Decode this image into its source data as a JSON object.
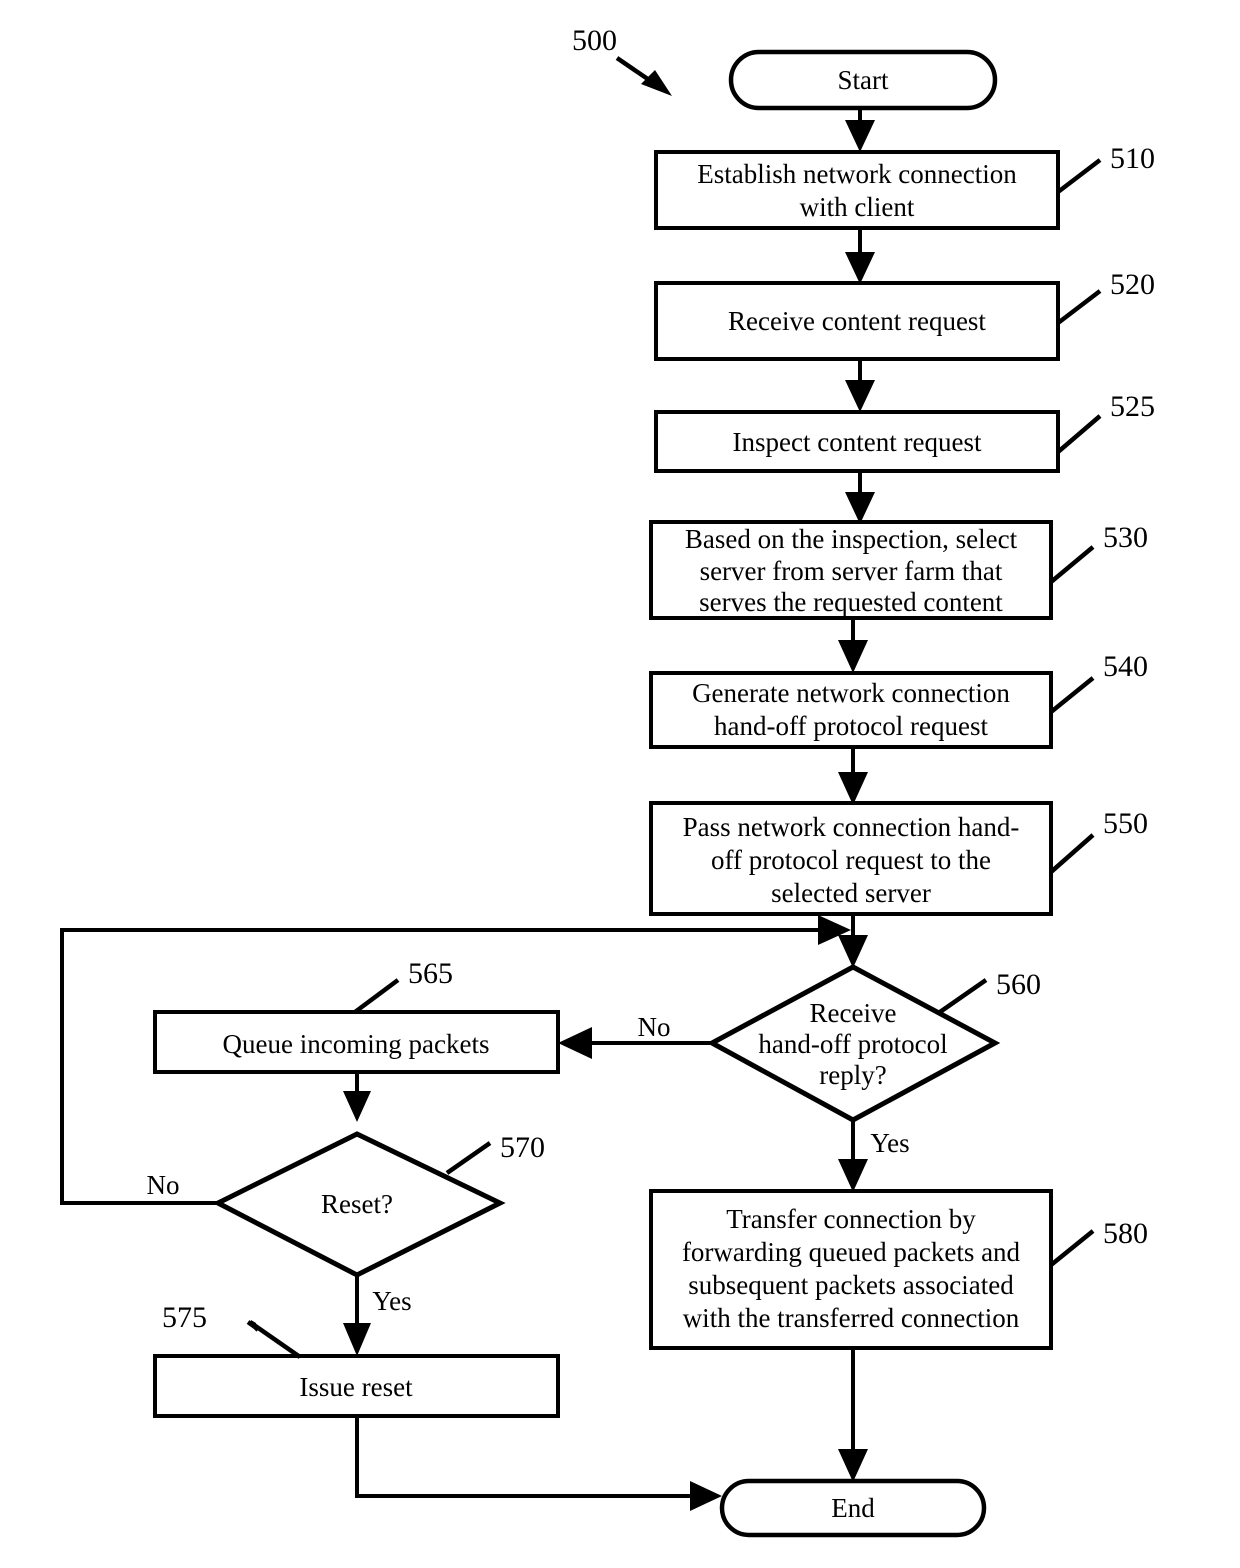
{
  "figure": {
    "figure_number": "500",
    "nodes": [
      {
        "id": "start",
        "ref": "",
        "type": "terminal",
        "label": "Start"
      },
      {
        "id": "n510",
        "ref": "510",
        "type": "process",
        "lines": [
          "Establish network connection",
          "with client"
        ]
      },
      {
        "id": "n520",
        "ref": "520",
        "type": "process",
        "lines": [
          "Receive content request"
        ]
      },
      {
        "id": "n525",
        "ref": "525",
        "type": "process",
        "lines": [
          "Inspect content request"
        ]
      },
      {
        "id": "n530",
        "ref": "530",
        "type": "process",
        "lines": [
          "Based on the inspection, select",
          "server from server farm that",
          "serves the requested content"
        ]
      },
      {
        "id": "n540",
        "ref": "540",
        "type": "process",
        "lines": [
          "Generate network connection",
          "hand-off protocol request"
        ]
      },
      {
        "id": "n550",
        "ref": "550",
        "type": "process",
        "lines": [
          "Pass network connection hand-",
          "off protocol request to the",
          "selected server"
        ]
      },
      {
        "id": "n560",
        "ref": "560",
        "type": "decision",
        "lines": [
          "Receive",
          "hand-off protocol",
          "reply?"
        ]
      },
      {
        "id": "n565",
        "ref": "565",
        "type": "process",
        "lines": [
          "Queue incoming packets"
        ]
      },
      {
        "id": "n570",
        "ref": "570",
        "type": "decision",
        "lines": [
          "Reset?"
        ]
      },
      {
        "id": "n575",
        "ref": "575",
        "type": "process",
        "lines": [
          "Issue reset"
        ]
      },
      {
        "id": "n580",
        "ref": "580",
        "type": "process",
        "lines": [
          "Transfer connection by",
          "forwarding queued packets and",
          "subsequent packets associated",
          "with the transferred connection"
        ]
      },
      {
        "id": "end",
        "ref": "",
        "type": "terminal",
        "label": "End"
      }
    ],
    "edge_labels": {
      "n560_no": "No",
      "n560_yes": "Yes",
      "n570_no": "No",
      "n570_yes": "Yes"
    },
    "colors": {
      "stroke": "#000000",
      "fill": "#ffffff",
      "background": "#ffffff"
    }
  }
}
